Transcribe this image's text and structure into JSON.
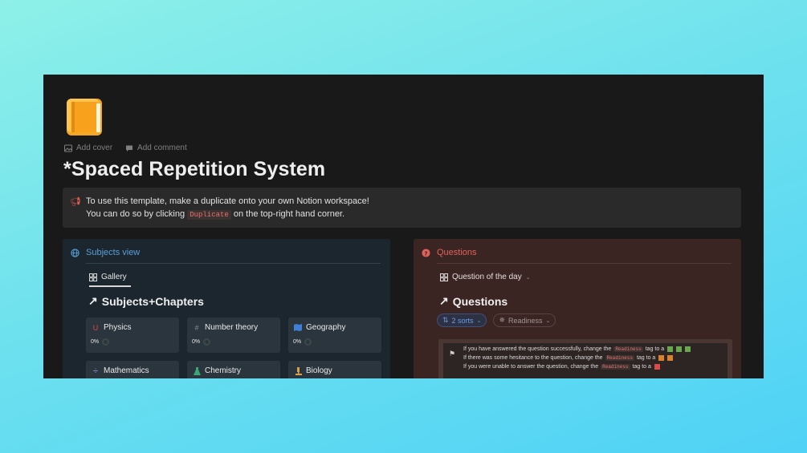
{
  "page": {
    "icon": "orange-book-icon",
    "add_cover": "Add cover",
    "add_comment": "Add comment",
    "title": "*Spaced Repetition System"
  },
  "callout": {
    "icon": "megaphone-icon",
    "line1": "To use this template, make a duplicate onto your own Notion workspace!",
    "line2_prefix": "You can do so by clicking",
    "line2_code": "Duplicate",
    "line2_suffix": "on the top-right hand corner."
  },
  "subjects": {
    "header": "Subjects view",
    "tab": "Gallery",
    "db_title": "Subjects+Chapters",
    "cards": [
      {
        "name": "Physics",
        "icon": "magnet-icon",
        "progress": "0%"
      },
      {
        "name": "Number theory",
        "icon": "hash-icon",
        "progress": "0%"
      },
      {
        "name": "Geography",
        "icon": "map-icon",
        "progress": "0%"
      },
      {
        "name": "Mathematics",
        "icon": "math-icon"
      },
      {
        "name": "Chemistry",
        "icon": "flask-icon"
      },
      {
        "name": "Biology",
        "icon": "microscope-icon"
      }
    ]
  },
  "questions": {
    "header": "Questions",
    "tab": "Question of the day",
    "db_title": "Questions",
    "sorts": "2 sorts",
    "filter": "Readiness",
    "note": {
      "line1_prefix": "If you have answered the question successfully, change the",
      "line2_prefix": "If there was some hesitance to the question, change the",
      "line3_prefix": "If you were unable to answer the question, change the",
      "code": "Readiness",
      "tag_suffix": "tag to a"
    }
  },
  "colors": {
    "accent_blue": "#5a9fd8",
    "accent_red": "#e0625a",
    "green": "#6aa84f",
    "orange": "#d9822b",
    "red": "#d94b4b"
  }
}
